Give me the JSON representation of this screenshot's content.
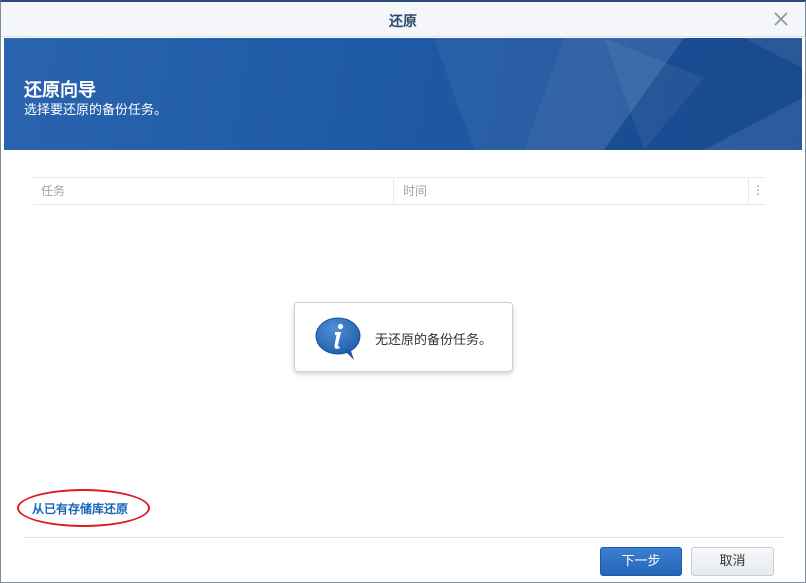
{
  "window": {
    "title": "还原"
  },
  "banner": {
    "title": "还原向导",
    "subtitle": "选择要还原的备份任务。"
  },
  "grid": {
    "columns": [
      "任务",
      "时间"
    ],
    "menu_glyph": "⋮"
  },
  "empty_state": {
    "icon": "info-icon",
    "message": "无还原的备份任务。"
  },
  "restore_link": {
    "label": "从已有存储库还原"
  },
  "footer": {
    "next_label": "下一步",
    "cancel_label": "取消"
  },
  "colors": {
    "banner": "#1f5aa6",
    "link": "#1a67b8",
    "primary_button": "#2566b8",
    "annotation": "#e0191f"
  }
}
